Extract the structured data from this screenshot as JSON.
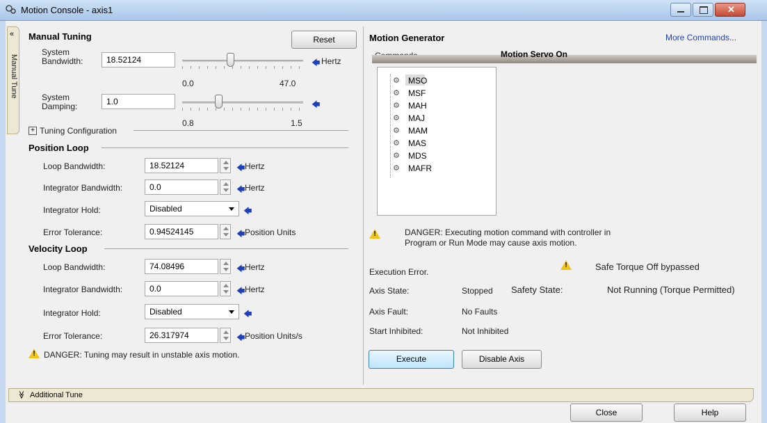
{
  "window": {
    "title": "Motion Console - axis1"
  },
  "side_tab": {
    "label": "Manual Tune",
    "collapse_glyph": "«"
  },
  "manual_tuning": {
    "header": "Manual Tuning",
    "reset_label": "Reset",
    "system_bandwidth": {
      "label_line1": "System",
      "label_line2": "Bandwidth:",
      "value": "18.52124",
      "unit": "Hertz",
      "min": "0.0",
      "max": "47.0"
    },
    "system_damping": {
      "label_line1": "System",
      "label_line2": "Damping:",
      "value": "1.0",
      "min": "0.8",
      "max": "1.5"
    },
    "tuning_config": "Tuning Configuration",
    "expand_glyph": "+"
  },
  "position_loop": {
    "header": "Position Loop",
    "loop_bandwidth": {
      "label": "Loop Bandwidth:",
      "value": "18.52124",
      "unit": "Hertz"
    },
    "integrator_bandwidth": {
      "label": "Integrator Bandwidth:",
      "value": "0.0",
      "unit": "Hertz"
    },
    "integrator_hold": {
      "label": "Integrator Hold:",
      "value": "Disabled"
    },
    "error_tolerance": {
      "label": "Error Tolerance:",
      "value": "0.94524145",
      "unit": "Position Units"
    }
  },
  "velocity_loop": {
    "header": "Velocity Loop",
    "loop_bandwidth": {
      "label": "Loop Bandwidth:",
      "value": "74.08496",
      "unit": "Hertz"
    },
    "integrator_bandwidth": {
      "label": "Integrator Bandwidth:",
      "value": "0.0",
      "unit": "Hertz"
    },
    "integrator_hold": {
      "label": "Integrator Hold:",
      "value": "Disabled"
    },
    "error_tolerance": {
      "label": "Error Tolerance:",
      "value": "26.317974",
      "unit": "Position Units/s"
    }
  },
  "tuning_warning": "DANGER: Tuning may result in unstable axis motion.",
  "motion_generator": {
    "header": "Motion Generator",
    "more_commands": "More Commands...",
    "commands_label": "Commands",
    "status": "Motion Servo On",
    "commands": [
      "MSO",
      "MSF",
      "MAH",
      "MAJ",
      "MAM",
      "MAS",
      "MDS",
      "MAFR"
    ],
    "danger_line1": "DANGER: Executing motion command with controller in",
    "danger_line2": "Program or Run Mode may cause axis motion.",
    "execution_error": "Execution Error.",
    "safe_torque": "Safe Torque Off bypassed",
    "axis_state_label": "Axis State:",
    "axis_state": "Stopped",
    "safety_state_label": "Safety State:",
    "safety_state": "Not Running (Torque Permitted)",
    "axis_fault_label": "Axis Fault:",
    "axis_fault": "No Faults",
    "start_inhibited_label": "Start Inhibited:",
    "start_inhibited": "Not Inhibited",
    "execute_label": "Execute",
    "disable_axis_label": "Disable Axis"
  },
  "additional_tune": {
    "label": "Additional Tune",
    "glyph": "≫"
  },
  "footer": {
    "close_label": "Close",
    "help_label": "Help"
  },
  "colors": {
    "accent": "#1d3fb8",
    "warning": "#f0c419",
    "link": "#1d3fb8"
  }
}
